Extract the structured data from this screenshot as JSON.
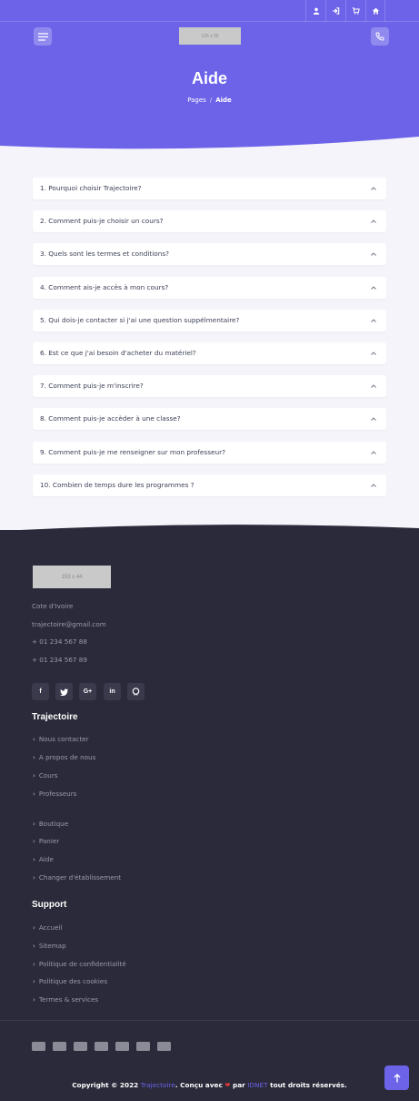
{
  "header": {
    "logo_placeholder": "125 x 30",
    "title": "Aide",
    "breadcrumb": {
      "parent": "Pages",
      "separator": "/",
      "current": "Aide"
    },
    "topbar_icons": [
      "user-icon",
      "sign-in-icon",
      "cart-icon",
      "home-icon"
    ]
  },
  "faq": {
    "items": [
      "1. Pourquoi choisir Trajectoire?",
      "2. Comment puis-je choisir un cours?",
      "3. Quels sont les termes et conditions?",
      "4. Comment ais-je accès à mon cours?",
      "5. Qui dois-je contacter si j'ai une question suppélmentaire?",
      "6. Est ce que j'ai besoin d'acheter du matériel?",
      "7. Comment puis-je m'inscrire?",
      "8. Comment puis-je accèder à une classe?",
      "9. Comment puis-je me renseigner sur mon professeur?",
      "10. Combien de temps dure les programmes ?"
    ]
  },
  "footer": {
    "logo_placeholder": "153 x 44",
    "contact": [
      "Cote d'Ivoire",
      "trajectoire@gmail.com",
      "+ 01 234 567 88",
      "+ 01 234 567 89"
    ],
    "social": [
      "facebook-icon",
      "twitter-icon",
      "google-plus-icon",
      "linkedin-icon",
      "github-icon"
    ],
    "social_labels": [
      "f",
      "t",
      "G+",
      "in",
      "gh"
    ],
    "section1_title": "Trajectoire",
    "section1_links": [
      "Nous contacter",
      "A propos de nous",
      "Cours",
      "Professeurs",
      "Boutique",
      "Panier",
      "Aide",
      "Changer d'établissement"
    ],
    "section2_title": "Support",
    "section2_links": [
      "Accueil",
      "Sitemap",
      "Politique de confidentialité",
      "Politique des cookies",
      "Termes & services"
    ],
    "payment_icons": [
      "amex-icon",
      "visa-icon",
      "card-icon",
      "mastercard-icon",
      "paypal-icon",
      "credit-card-icon",
      "stripe-icon"
    ],
    "copyright": {
      "prefix": "Copyright © 2022 ",
      "brand": "Trajectoire",
      "middle": ". Conçu avec ",
      "heart": "❤",
      "by": " par ",
      "company": "IDNET",
      "suffix": " tout droits réservés."
    }
  },
  "colors": {
    "primary": "#6c63e8",
    "footer_bg": "#2a2a3a",
    "page_bg": "#f5f4fa"
  }
}
